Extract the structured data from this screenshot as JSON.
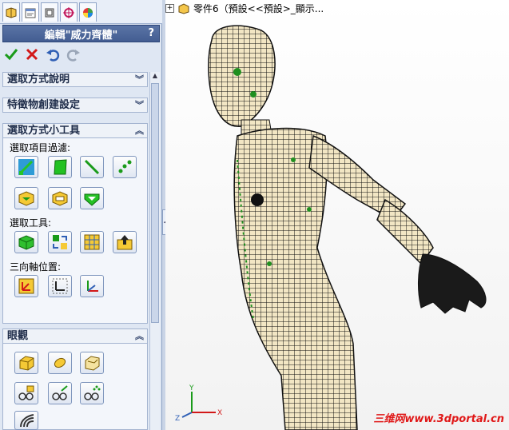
{
  "feature_tree": {
    "expand_glyph": "+",
    "item_text": "零件6（預設<<預設>_顯示..."
  },
  "property_manager": {
    "tabs": [
      "feature-manager",
      "property-manager",
      "configuration-manager",
      "dimxpert-manager",
      "display-manager"
    ],
    "title": "編輯\"威力齊體\"",
    "help": "?",
    "sections": {
      "selection_help": "選取方式說明",
      "feature_settings": "特徵物創建設定",
      "selection_tools": "選取方式小工具",
      "view": "眼觀"
    },
    "labels": {
      "filter": "選取項目過濾:",
      "select_tools": "選取工具:",
      "triad": "三向軸位置:"
    }
  },
  "watermark": "三维网www.3dportal.cn",
  "colors": {
    "mesh_fill": "#f2e6c4",
    "mesh_line": "#111111",
    "accent_green": "#1f8f1f",
    "panel_bg": "#dfe7f3"
  }
}
